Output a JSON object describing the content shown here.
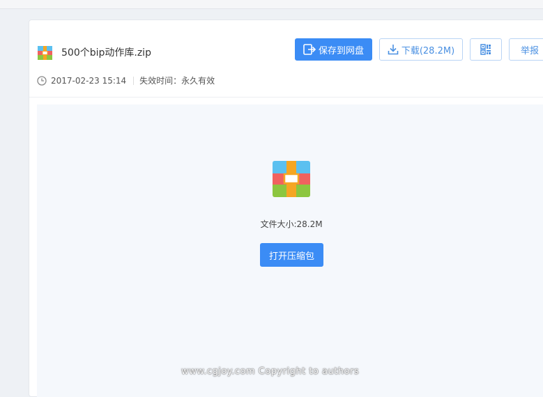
{
  "file": {
    "name": "500个bip动作库.zip",
    "date": "2017-02-23 15:14",
    "expiry": "失效时间：永久有效"
  },
  "toolbar": {
    "save_label": "保存到网盘",
    "download_label": "下载(28.2M)",
    "report_label": "举报"
  },
  "preview": {
    "size_text": "文件大小:28.2M",
    "open_label": "打开压缩包"
  },
  "watermark": "www.cgjoy.com  Copyright to authors",
  "colors": {
    "accent": "#3b8cf5",
    "zip_blue": "#5bc0f0",
    "zip_red": "#f0625f",
    "zip_green": "#8cc63f",
    "zip_orange": "#f5a623"
  },
  "icons": {
    "file": "zip-archive-icon",
    "save": "save-to-disk-icon",
    "download": "download-icon",
    "qr": "qr-code-icon",
    "clock": "clock-icon"
  }
}
